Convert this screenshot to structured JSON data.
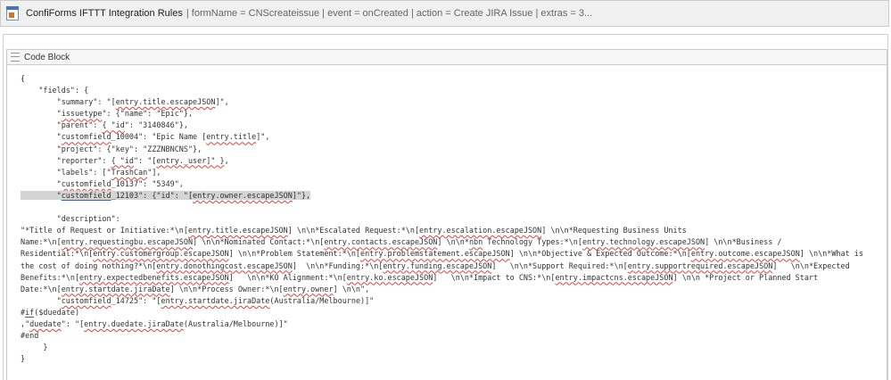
{
  "macro": {
    "title": "ConfiForms IFTTT Integration Rules",
    "params": "| formName = CNScreateissue | event = onCreated | action = Create JIRA Issue | extras = 3..."
  },
  "code_block": {
    "title": "Code Block",
    "lines": [
      [
        {
          "t": "{"
        }
      ],
      [
        {
          "t": "    \"fields\": {"
        }
      ],
      [
        {
          "t": "        \"summary\": \"["
        },
        {
          "t": "entry.title.escapeJSON",
          "c": "sp"
        },
        {
          "t": "]\","
        }
      ],
      [
        {
          "t": "        \""
        },
        {
          "t": "issuetype",
          "c": "sp"
        },
        {
          "t": "\": {\"name\": \"Epic\"},"
        }
      ],
      [
        {
          "t": "        \"parent\": "
        },
        {
          "t": "{ \"id",
          "c": "sp"
        },
        {
          "t": "\": \"3140846\"},"
        }
      ],
      [
        {
          "t": "        \""
        },
        {
          "t": "customfield",
          "c": "sp"
        },
        {
          "t": "_10004\": \"Epic Name ["
        },
        {
          "t": "entry.title",
          "c": "sp"
        },
        {
          "t": "]\","
        }
      ],
      [
        {
          "t": "        \"project\": {\"key\": \"ZZZNBNCNS\"},"
        }
      ],
      [
        {
          "t": "        \"reporter\": "
        },
        {
          "t": "{ \"id",
          "c": "sp"
        },
        {
          "t": "\": \"["
        },
        {
          "t": "entry._user]\" }",
          "c": "sp"
        },
        {
          "t": ","
        }
      ],
      [
        {
          "t": "        \"labels\": [\""
        },
        {
          "t": "TrashCan",
          "c": "sp"
        },
        {
          "t": "\"],"
        }
      ],
      [
        {
          "t": "        \""
        },
        {
          "t": "customfield",
          "c": "sp"
        },
        {
          "t": "_10137\": \"5349\","
        }
      ],
      [
        {
          "t": "        \"",
          "c": "hl"
        },
        {
          "t": "customfield",
          "c": "hl bl"
        },
        {
          "t": "_12103\": {\"id\": \"[",
          "c": "hl"
        },
        {
          "t": "entry.owner.escapeJSON",
          "c": "hl sp"
        },
        {
          "t": "]\"},",
          "c": "hl"
        }
      ],
      [
        {
          "t": ""
        }
      ],
      [
        {
          "t": "        \"description\":"
        }
      ],
      [
        {
          "t": "\"*Title of Request or Initiative:*\\n["
        },
        {
          "t": "entry.title.escapeJSON",
          "c": "sp"
        },
        {
          "t": "] \\n\\n*Escalated Request:*\\n["
        },
        {
          "t": "entry.escalation.escapeJSON",
          "c": "sp"
        },
        {
          "t": "] \\n\\n*Requesting Business Units"
        }
      ],
      [
        {
          "t": "Name:*\\n["
        },
        {
          "t": "entry.requestingbu.escapeJSON",
          "c": "sp"
        },
        {
          "t": "] \\n\\n*Nominated Contact:*\\n["
        },
        {
          "t": "entry.contacts.escapeJSON",
          "c": "sp"
        },
        {
          "t": "] \\n\\n*"
        },
        {
          "t": "nbn",
          "c": "sp"
        },
        {
          "t": " Technology Types:*\\n["
        },
        {
          "t": "entry.technology.escapeJSON",
          "c": "sp"
        },
        {
          "t": "] \\n\\n*Business /"
        }
      ],
      [
        {
          "t": "Residential:*\\n["
        },
        {
          "t": "entry.customergroup.escapeJSON",
          "c": "sp"
        },
        {
          "t": "] \\n\\n*Problem Statement:*\\n["
        },
        {
          "t": "entry.problemstatement.escapeJSON",
          "c": "sp"
        },
        {
          "t": "] \\n\\n*Objective & Expected Outcome:*\\n["
        },
        {
          "t": "entry.outcome.escapeJSON",
          "c": "sp"
        },
        {
          "t": "] \\n\\n*What is"
        }
      ],
      [
        {
          "t": "the cost of doing nothing?*\\n["
        },
        {
          "t": "entry.donothingcost.escapeJSON",
          "c": "sp"
        },
        {
          "t": "]  \\n\\n*Funding:*\\n["
        },
        {
          "t": "entry.funding.escapeJSON",
          "c": "sp"
        },
        {
          "t": "]   \\n\\n*Support Required:*\\n["
        },
        {
          "t": "entry.supportrequired.escapeJSON",
          "c": "sp"
        },
        {
          "t": "]   \\n\\n*Expected"
        }
      ],
      [
        {
          "t": "Benefits:*\\n["
        },
        {
          "t": "entry.expectedbenefits.escapeJSON",
          "c": "sp"
        },
        {
          "t": "]   \\n\\n*KO Alignment:*\\n["
        },
        {
          "t": "entry.ko.escapeJSON",
          "c": "sp"
        },
        {
          "t": "]   \\n\\n*Impact to CNS:*\\n["
        },
        {
          "t": "entry.impactcns.escapeJSON",
          "c": "sp"
        },
        {
          "t": "] \\n\\n *Project or Planned Start"
        }
      ],
      [
        {
          "t": "Date:*\\n["
        },
        {
          "t": "entry.startdate.jiraDate",
          "c": "sp"
        },
        {
          "t": "] \\n\\n*Process Owner:*\\n["
        },
        {
          "t": "entry.owner",
          "c": "sp"
        },
        {
          "t": "] \\n\\n\","
        }
      ],
      [
        {
          "t": "        \""
        },
        {
          "t": "customfield",
          "c": "sp"
        },
        {
          "t": "_14725\": \"["
        },
        {
          "t": "entry.startdate.jiraDate",
          "c": "sp"
        },
        {
          "t": "(Australia/Melbourne)]\""
        }
      ],
      [
        {
          "t": "#"
        },
        {
          "t": "if",
          "c": "bl"
        },
        {
          "t": "($duedate)"
        }
      ],
      [
        {
          "t": ",\""
        },
        {
          "t": "duedate",
          "c": "sp"
        },
        {
          "t": "\": \"["
        },
        {
          "t": "entry.duedate.jiraDate",
          "c": "sp"
        },
        {
          "t": "(Australia/Melbourne)]\""
        }
      ],
      [
        {
          "t": "#end"
        }
      ],
      [
        {
          "t": "     }"
        }
      ],
      [
        {
          "t": "}"
        }
      ]
    ]
  }
}
